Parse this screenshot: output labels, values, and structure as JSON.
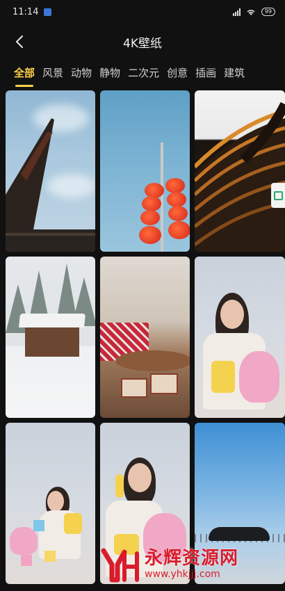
{
  "status_bar": {
    "time": "11:14",
    "battery": "99"
  },
  "header": {
    "title": "4K壁纸"
  },
  "tabs": [
    {
      "label": "全部",
      "active": true
    },
    {
      "label": "风景"
    },
    {
      "label": "动物"
    },
    {
      "label": "静物"
    },
    {
      "label": "二次元"
    },
    {
      "label": "创意"
    },
    {
      "label": "插画"
    },
    {
      "label": "建筑"
    }
  ],
  "watermark": {
    "title": "永辉资源网",
    "url": "www.yhkjjj.com"
  },
  "colors": {
    "background": "#111111",
    "accent": "#ffd24a",
    "watermark": "#d81c2c"
  }
}
